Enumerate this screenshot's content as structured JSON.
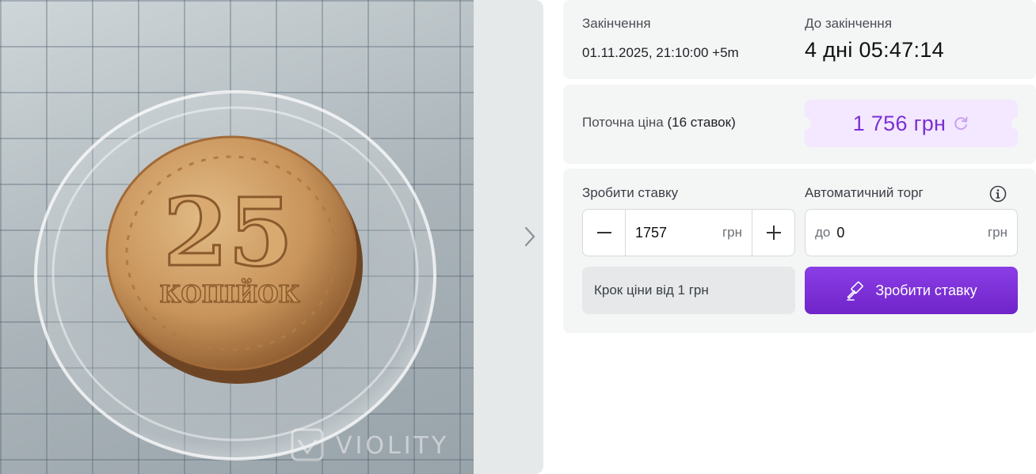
{
  "gallery": {
    "next_icon": "chevron-right-icon",
    "watermark": "VIOLITY",
    "coin_denomination": "25",
    "coin_text": "КОПІЙОК"
  },
  "auction": {
    "end_label": "Закінчення",
    "end_value": "01.11.2025, 21:10:00 +5m",
    "remaining_label": "До закінчення",
    "remaining_value": "4 дні 05:47:14"
  },
  "price": {
    "label": "Поточна ціна",
    "bids_count": "(16 ставок)",
    "value": "1 756 грн",
    "refresh_icon": "refresh-icon"
  },
  "bid": {
    "make_bid_label": "Зробити ставку",
    "bid_value": "1757",
    "unit": "грн",
    "decrement_icon": "minus-icon",
    "increment_icon": "plus-icon",
    "auto_label": "Автоматичний торг",
    "info_icon": "info-icon",
    "auto_prefix": "до",
    "auto_value": "0",
    "auto_unit": "грн",
    "step_note": "Крок ціни від 1 грн",
    "submit_label": "Зробити ставку",
    "submit_icon": "gavel-icon"
  },
  "colors": {
    "accent": "#7b2fd6",
    "price_badge_bg": "#f3e8ff",
    "card_bg": "#f4f5f5"
  }
}
